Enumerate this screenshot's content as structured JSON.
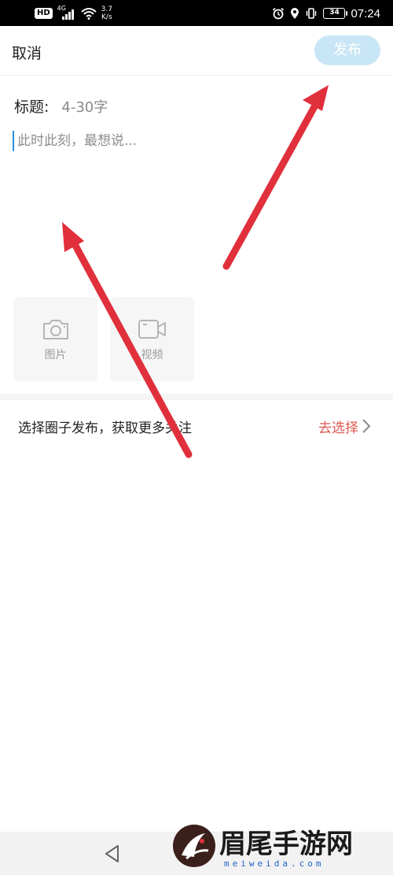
{
  "status_bar": {
    "network_badge": "HD",
    "signal_type": "4G",
    "speed_value": "3.7",
    "speed_unit": "K/s",
    "battery": "34",
    "time": "07:24"
  },
  "header": {
    "cancel_label": "取消",
    "publish_label": "发布"
  },
  "form": {
    "title_label": "标题:",
    "title_placeholder": "4-30字",
    "content_placeholder": "此时此刻，最想说..."
  },
  "media": {
    "photo_label": "图片",
    "photo_icon": "camera-icon",
    "video_label": "视频",
    "video_icon": "video-camera-icon"
  },
  "circle": {
    "prompt": "选择圈子发布，获取更多关注",
    "action": "去选择"
  },
  "colors": {
    "publish_bg": "#c9e6f6",
    "accent_red": "#e0574f",
    "arrow_red": "#e0303c",
    "caret": "#2a8fe0"
  },
  "watermark": {
    "brand": "眉尾手游网",
    "domain_text": "meiweida.com"
  }
}
